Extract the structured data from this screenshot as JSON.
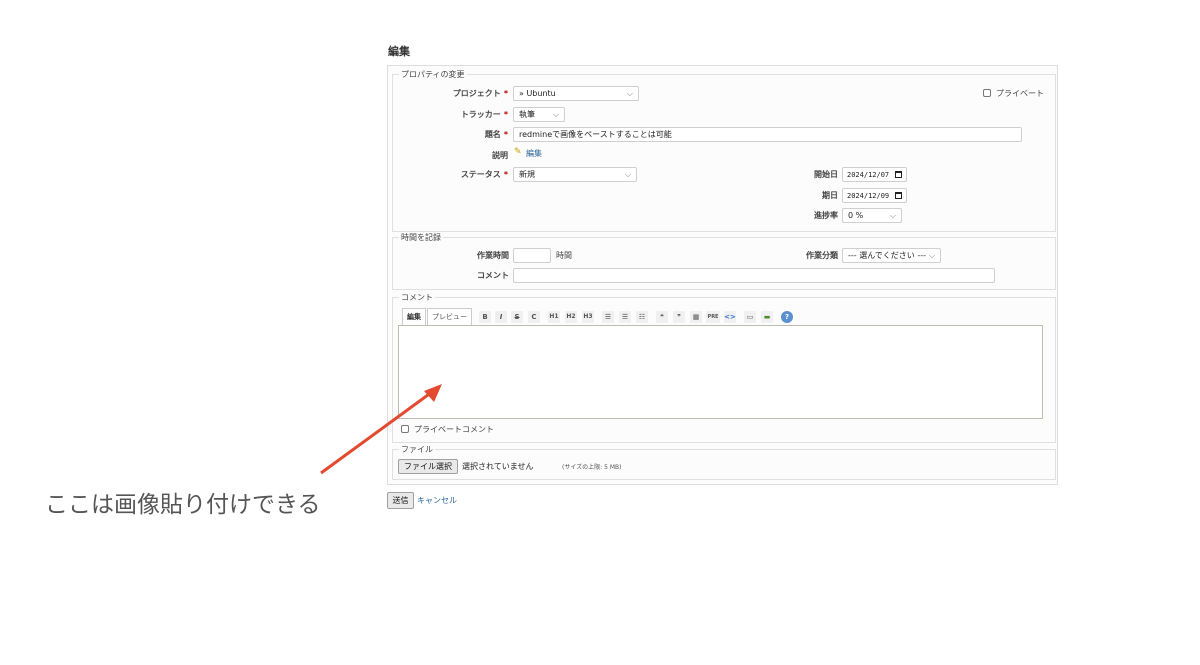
{
  "page_title": "編集",
  "properties": {
    "legend": "プロパティの変更",
    "project_label": "プロジェクト",
    "project_value": "» Ubuntu",
    "private_label": "プライベート",
    "tracker_label": "トラッカー",
    "tracker_value": "執筆",
    "subject_label": "題名",
    "subject_value": "redmineで画像をペーストすることは可能",
    "description_label": "説明",
    "description_edit_link": "編集",
    "status_label": "ステータス",
    "status_value": "新規",
    "start_date_label": "開始日",
    "start_date_value": "2024/12/07",
    "due_date_label": "期日",
    "due_date_value": "2024/12/09",
    "progress_label": "進捗率",
    "progress_value": "0 %",
    "required_mark": "*"
  },
  "time_entry": {
    "legend": "時間を記録",
    "hours_label": "作業時間",
    "hours_value": "",
    "hours_unit": "時間",
    "activity_label": "作業分類",
    "activity_value": "--- 選んでください ---",
    "comment_label": "コメント",
    "comment_value": ""
  },
  "notes": {
    "legend": "コメント",
    "tab_edit": "編集",
    "tab_preview": "プレビュー",
    "toolbar": {
      "bold": "B",
      "italic": "I",
      "strike": "S",
      "code": "C",
      "h1": "H1",
      "h2": "H2",
      "h3": "H3",
      "pre": "PRE",
      "link": "<>",
      "help": "?"
    },
    "private_notes_label": "プライベートコメント"
  },
  "attachments": {
    "legend": "ファイル",
    "choose_button": "ファイル選択",
    "no_file_text": "選択されていません",
    "max_size_text": "(サイズの上限: 5 MB)"
  },
  "actions": {
    "submit_label": "送信",
    "cancel_label": "キャンセル"
  },
  "annotation": {
    "text": "ここは画像貼り付けできる",
    "arrow_color": "#e34a30"
  }
}
